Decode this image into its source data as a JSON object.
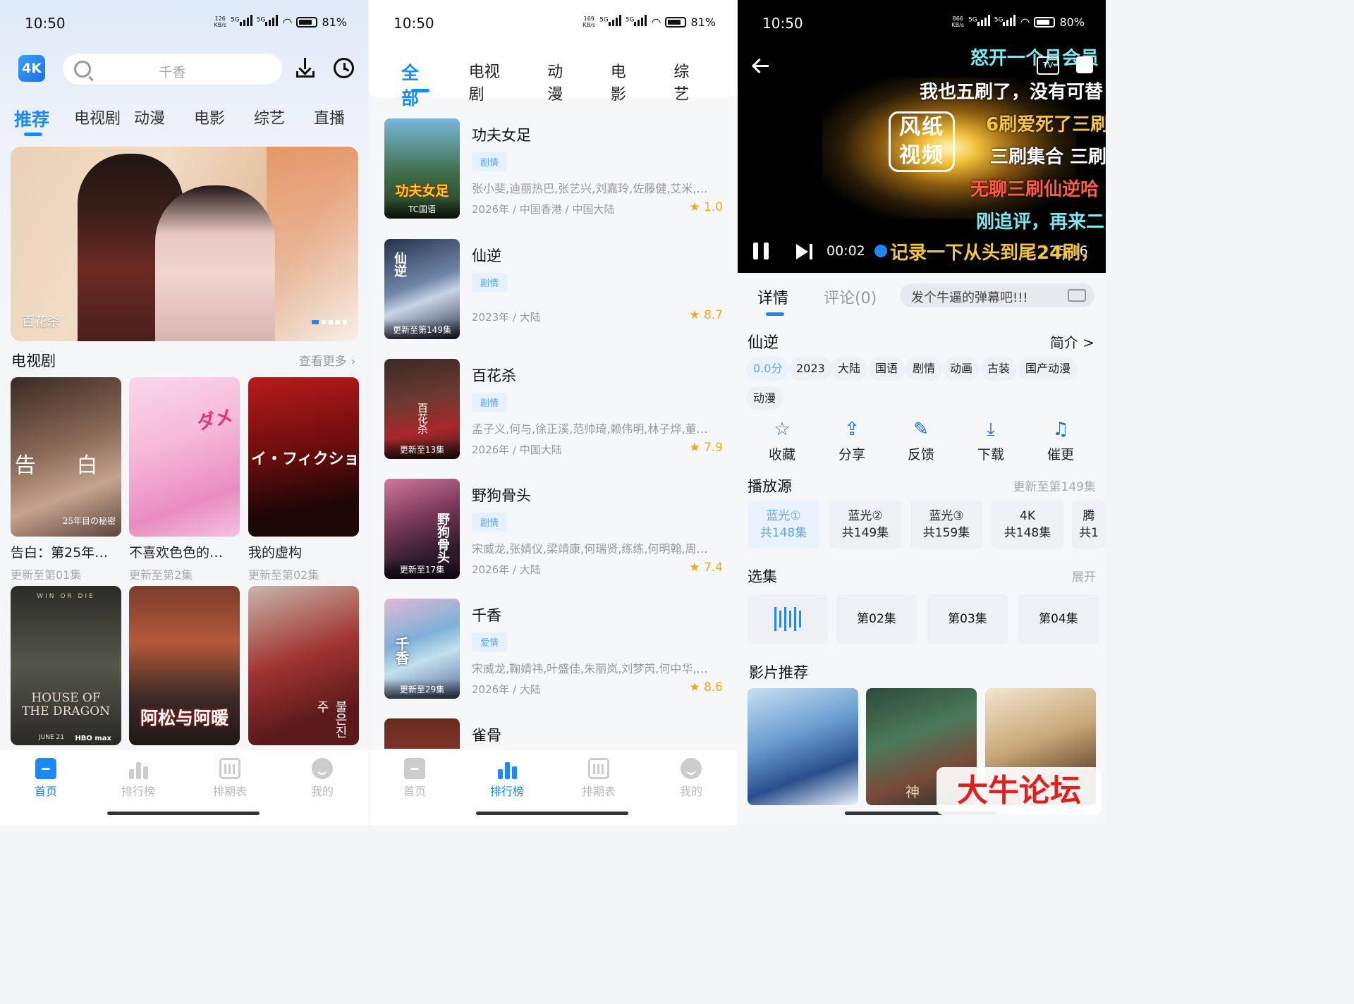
{
  "status": {
    "s1": {
      "time": "10:50",
      "speed": "126",
      "speed_unit": "KB/s",
      "net1": "5G",
      "net2": "5G",
      "battery": "81%"
    },
    "s2": {
      "time": "10:50",
      "speed": "169",
      "speed_unit": "KB/s",
      "net1": "5G",
      "net2": "5G",
      "battery": "81%"
    },
    "s3": {
      "time": "10:50",
      "speed": "866",
      "speed_unit": "KB/s",
      "net1": "5G",
      "net2": "5G",
      "battery": "80%"
    }
  },
  "home": {
    "logo": "4K",
    "search_placeholder": "千香",
    "tabs": [
      "推荐",
      "电视剧",
      "动漫",
      "电影",
      "综艺",
      "直播"
    ],
    "banner_title": "百花杀",
    "section_title": "电视剧",
    "section_more": "查看更多 ›",
    "cards": [
      {
        "name": "告白：第25年…",
        "sub": "更新至第01集",
        "text": "告 白",
        "text2": "25年目の秘密"
      },
      {
        "name": "不喜欢色色的…",
        "sub": "更新至第2集",
        "text": "ダメ"
      },
      {
        "name": "我的虚构",
        "sub": "更新至第02集",
        "text": "イ・フィクショ"
      },
      {
        "name": "",
        "sub": "",
        "text": "HOUSE OF THE DRAGON",
        "text2": "HBO max",
        "text3": "WIN OR DIE",
        "text4": "JUNE 21"
      },
      {
        "name": "",
        "sub": "",
        "text": "阿松与阿暖"
      },
      {
        "name": "",
        "sub": "",
        "text": "불은진주"
      }
    ]
  },
  "nav": [
    "首页",
    "排行榜",
    "排期表",
    "我的"
  ],
  "rank": {
    "tabs": [
      "全部",
      "电视剧",
      "动漫",
      "电影",
      "综艺"
    ],
    "items": [
      {
        "title": "功夫女足",
        "tag": "剧情",
        "cast": "张小斐,迪丽热巴,张艺兴,刘嘉玲,佐藤健,艾米,…",
        "meta": "2026年 / 中国香港 / 中国大陆",
        "score": "★ 1.0",
        "badge": "TC国语",
        "poster_text": "功夫女足"
      },
      {
        "title": "仙逆",
        "tag": "剧情",
        "cast": "",
        "meta": "2023年 / 大陆",
        "score": "★ 8.7",
        "badge": "更新至第149集",
        "poster_text": "仙逆"
      },
      {
        "title": "百花杀",
        "tag": "剧情",
        "cast": "孟子义,何与,徐正溪,范帅琦,赖伟明,林子烨,董…",
        "meta": "2026年 / 中国大陆",
        "score": "★ 7.9",
        "badge": "更新至13集",
        "poster_text": "百花杀"
      },
      {
        "title": "野狗骨头",
        "tag": "剧情",
        "cast": "宋威龙,张婧仪,梁靖康,何瑞贤,练练,何明翰,周…",
        "meta": "2026年 / 大陆",
        "score": "★ 7.4",
        "badge": "更新至17集",
        "poster_text": "野狗骨头"
      },
      {
        "title": "千香",
        "tag": "爱情",
        "cast": "宋威龙,鞠婧祎,叶盛佳,朱丽岚,刘梦芮,何中华,…",
        "meta": "2026年 / 大陆",
        "score": "★ 8.6",
        "badge": "更新至29集",
        "poster_text": "千香"
      },
      {
        "title": "雀骨",
        "tag": "",
        "cast": "",
        "meta": "",
        "score": "",
        "badge": "",
        "poster_text": ""
      }
    ]
  },
  "detail": {
    "danmaku": [
      "怒开一个月会员",
      "我也五刷了，没有可替",
      "6刷爱死了三刷",
      "三刷集合 三刷",
      "无聊三刷仙逆哈",
      "刚追评，再来二",
      "记录一下从头到尾24刷，"
    ],
    "watermark": "风纸视频",
    "tv_label": "TV",
    "current_time": "00:02",
    "duration": "25:46",
    "tab_detail": "详情",
    "tab_comments": "评论(0)",
    "danmaku_placeholder": "发个牛逼的弹幕吧!!!",
    "title": "仙逆",
    "intro": "简介 >",
    "chips": [
      "0.0分",
      "2023",
      "大陆",
      "国语",
      "剧情",
      "动画",
      "古装",
      "国产动漫",
      "动漫"
    ],
    "actions": [
      {
        "label": "收藏",
        "icon": "star-icon",
        "glyph": "☆"
      },
      {
        "label": "分享",
        "icon": "share-icon",
        "glyph": "⇪"
      },
      {
        "label": "反馈",
        "icon": "edit-icon",
        "glyph": "✎"
      },
      {
        "label": "下载",
        "icon": "download-icon",
        "glyph": "⤓"
      },
      {
        "label": "催更",
        "icon": "bell-icon",
        "glyph": "♫"
      }
    ],
    "source_title": "播放源",
    "source_status": "更新至第149集",
    "sources": [
      {
        "name": "蓝光①",
        "count": "共148集"
      },
      {
        "name": "蓝光②",
        "count": "共149集"
      },
      {
        "name": "蓝光③",
        "count": "共159集"
      },
      {
        "name": "4K",
        "count": "共148集"
      },
      {
        "name": "腾",
        "count": "共1"
      }
    ],
    "episode_title": "选集",
    "episode_expand": "展开",
    "episodes": [
      "",
      "第02集",
      "第03集",
      "第04集"
    ],
    "recommend_title": "影片推荐",
    "recommend_text": "神",
    "site_watermark": "大牛论坛"
  },
  "colors": {
    "accent": "#1e88f5",
    "score": "#f5a623",
    "tag_bg": "#e6f1ff",
    "danmaku_yellow": "#f4c542",
    "danmaku_red": "#ff5a4a",
    "danmaku_cyan": "#7fe6f0",
    "watermark_red": "#e02020"
  }
}
